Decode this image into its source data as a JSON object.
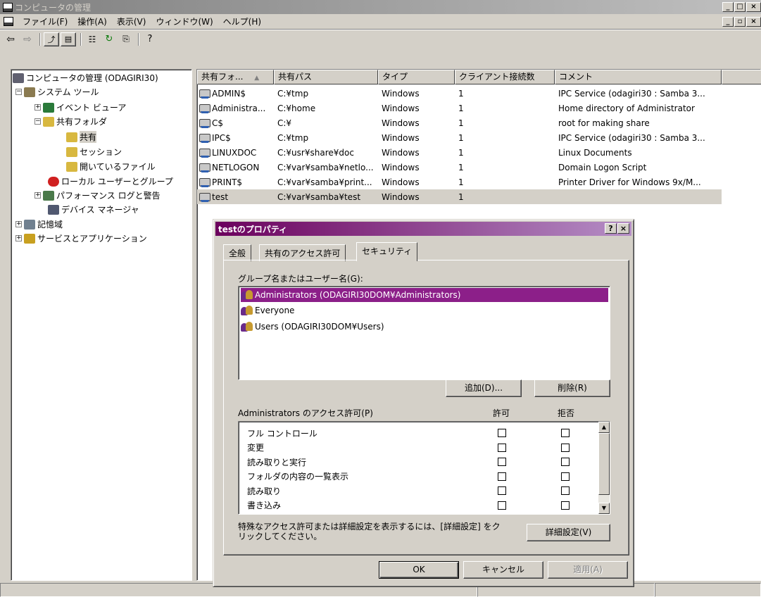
{
  "window": {
    "title": "コンピュータの管理"
  },
  "menu": {
    "items": [
      "ファイル(F)",
      "操作(A)",
      "表示(V)",
      "ウィンドウ(W)",
      "ヘルプ(H)"
    ]
  },
  "tree": {
    "root": "コンピュータの管理 (ODAGIRI30)",
    "system_tools": "システム ツール",
    "event_viewer": "イベント ビューア",
    "shared_folders": "共有フォルダ",
    "shares": "共有",
    "sessions": "セッション",
    "open_files": "開いているファイル",
    "local_users": "ローカル ユーザーとグループ",
    "perf_logs": "パフォーマンス ログと警告",
    "device_manager": "デバイス マネージャ",
    "storage": "記憶域",
    "services_apps": "サービスとアプリケーション"
  },
  "list": {
    "columns": [
      "共有フォ...",
      "共有パス",
      "タイプ",
      "クライアント接続数",
      "コメント"
    ],
    "rows": [
      {
        "name": "ADMIN$",
        "path": "C:¥tmp",
        "type": "Windows",
        "clients": "1",
        "comment": "IPC Service (odagiri30 : Samba 3..."
      },
      {
        "name": "Administra...",
        "path": "C:¥home",
        "type": "Windows",
        "clients": "1",
        "comment": "Home directory of Administrator"
      },
      {
        "name": "C$",
        "path": "C:¥",
        "type": "Windows",
        "clients": "1",
        "comment": "root for making share"
      },
      {
        "name": "IPC$",
        "path": "C:¥tmp",
        "type": "Windows",
        "clients": "1",
        "comment": "IPC Service (odagiri30 : Samba 3..."
      },
      {
        "name": "LINUXDOC",
        "path": "C:¥usr¥share¥doc",
        "type": "Windows",
        "clients": "1",
        "comment": "Linux Documents"
      },
      {
        "name": "NETLOGON",
        "path": "C:¥var¥samba¥netlo...",
        "type": "Windows",
        "clients": "1",
        "comment": "Domain Logon Script"
      },
      {
        "name": "PRINT$",
        "path": "C:¥var¥samba¥print...",
        "type": "Windows",
        "clients": "1",
        "comment": "Printer Driver for Windows 9x/M..."
      },
      {
        "name": "test",
        "path": "C:¥var¥samba¥test",
        "type": "Windows",
        "clients": "1",
        "comment": ""
      }
    ]
  },
  "dialog": {
    "title": "testのプロパティ",
    "help_btn": "?",
    "close_btn": "×",
    "tabs": [
      "全般",
      "共有のアクセス許可",
      "セキュリティ"
    ],
    "group_label": "グループ名またはユーザー名(G):",
    "groups": [
      "Administrators (ODAGIRI30DOM¥Administrators)",
      "Everyone",
      "Users (ODAGIRI30DOM¥Users)"
    ],
    "add_btn": "追加(D)...",
    "remove_btn": "削除(R)",
    "perm_label": "Administrators のアクセス許可(P)",
    "allow_header": "許可",
    "deny_header": "拒否",
    "permissions": [
      "フル コントロール",
      "変更",
      "読み取りと実行",
      "フォルダの内容の一覧表示",
      "読み取り",
      "書き込み"
    ],
    "advanced_note": "特殊なアクセス許可または詳細設定を表示するには、[詳細設定] をクリックしてください。",
    "advanced_btn": "詳細設定(V)",
    "ok_btn": "OK",
    "cancel_btn": "キャンセル",
    "apply_btn": "適用(A)"
  }
}
